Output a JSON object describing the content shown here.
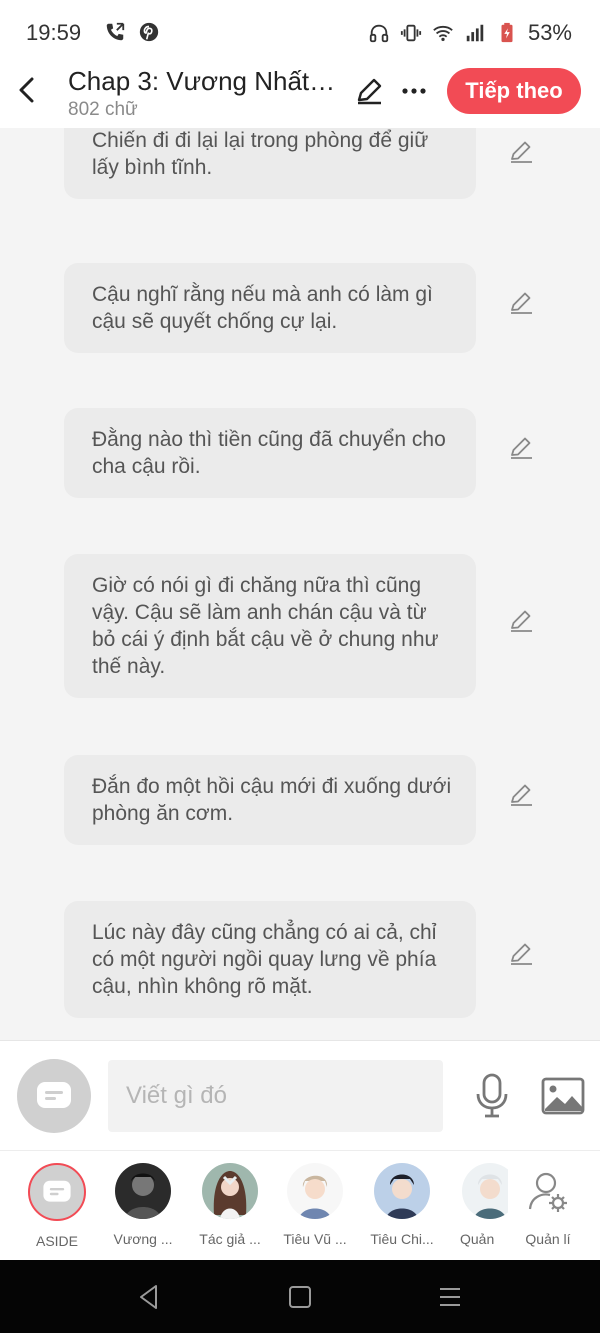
{
  "status_bar": {
    "time": "19:59",
    "battery": "53%",
    "icons_left": [
      "phone-call-icon",
      "pinterest-icon"
    ],
    "icons_right": [
      "headphones-icon",
      "vibrate-icon",
      "wifi-icon",
      "signal-icon",
      "battery-icon"
    ]
  },
  "header": {
    "title": "Chap 3: Vương Nhất ...",
    "word_count": "802 chữ",
    "next_label": "Tiếp theo"
  },
  "messages": [
    {
      "text": "Người quản gia trở xuống nhà, và Tiêu Chiến đi đi lại lại trong phòng để giữ lấy bình tĩnh."
    },
    {
      "text": "Cậu nghĩ rằng nếu mà anh có làm gì cậu sẽ quyết chống cự lại."
    },
    {
      "text": "Đằng nào thì tiền cũng đã chuyển cho cha cậu rồi."
    },
    {
      "text": "Giờ có nói gì đi chăng nữa thì cũng vậy. Cậu sẽ làm anh chán cậu và từ bỏ cái ý định bắt cậu về ở chung như thế này."
    },
    {
      "text": "Đắn đo một hồi cậu mới đi xuống dưới phòng ăn cơm."
    },
    {
      "text": "Lúc này đây cũng chẳng có ai cả, chỉ có một người ngồi quay lưng về phía cậu, nhìn không rõ mặt."
    }
  ],
  "composer": {
    "placeholder": "Viết gì đó"
  },
  "characters": [
    {
      "label": "ASIDE",
      "selected": true
    },
    {
      "label": "Vương ..."
    },
    {
      "label": "Tác giả ..."
    },
    {
      "label": "Tiêu Vũ ..."
    },
    {
      "label": "Tiêu Chi..."
    },
    {
      "label": "Quản"
    },
    {
      "label": "Quản lí"
    }
  ],
  "colors": {
    "accent": "#f24b55",
    "bubble": "#ebebeb",
    "background": "#f4f4f4"
  }
}
